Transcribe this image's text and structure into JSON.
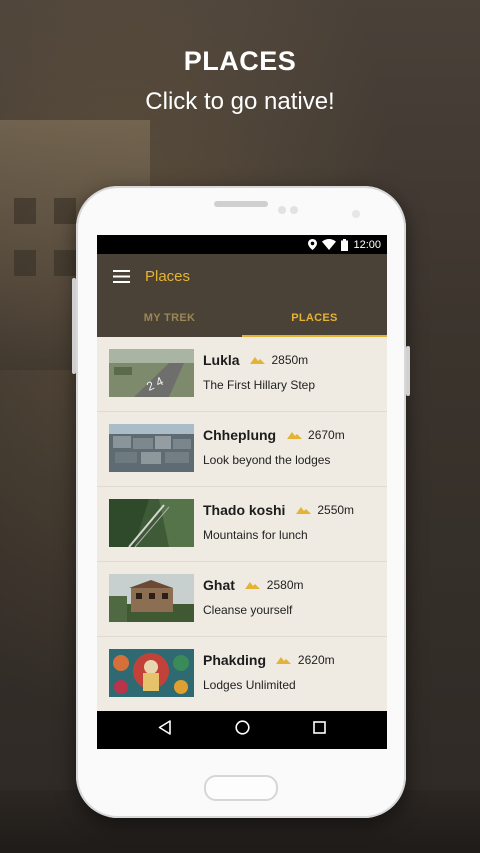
{
  "promo": {
    "headline": "PLACES",
    "subheadline": "Click to go native!"
  },
  "status_bar": {
    "time": "12:00",
    "icons": [
      "location-icon",
      "wifi-icon",
      "battery-icon"
    ]
  },
  "app_bar": {
    "title": "Places",
    "menu_icon": "hamburger-menu-icon"
  },
  "tabs": [
    {
      "label": "MY TREK",
      "active": false
    },
    {
      "label": "PLACES",
      "active": true
    }
  ],
  "places": [
    {
      "name": "Lukla",
      "altitude": "2850m",
      "tagline": "The First Hillary Step",
      "image": "airstrip"
    },
    {
      "name": "Chheplung",
      "altitude": "2670m",
      "tagline": "Look beyond the lodges",
      "image": "mani-stones"
    },
    {
      "name": "Thado koshi",
      "altitude": "2550m",
      "tagline": "Mountains for lunch",
      "image": "suspension-bridge"
    },
    {
      "name": "Ghat",
      "altitude": "2580m",
      "tagline": "Cleanse yourself",
      "image": "monastery"
    },
    {
      "name": "Phakding",
      "altitude": "2620m",
      "tagline": "Lodges Unlimited",
      "image": "thangka-painting"
    }
  ],
  "nav_bar": {
    "icons": [
      "back-icon",
      "home-icon",
      "recents-icon"
    ]
  },
  "colors": {
    "accent": "#e4b235",
    "app_bar": "#4a4237",
    "list_bg": "#f0ebe2",
    "tab_inactive": "#9b8656"
  }
}
